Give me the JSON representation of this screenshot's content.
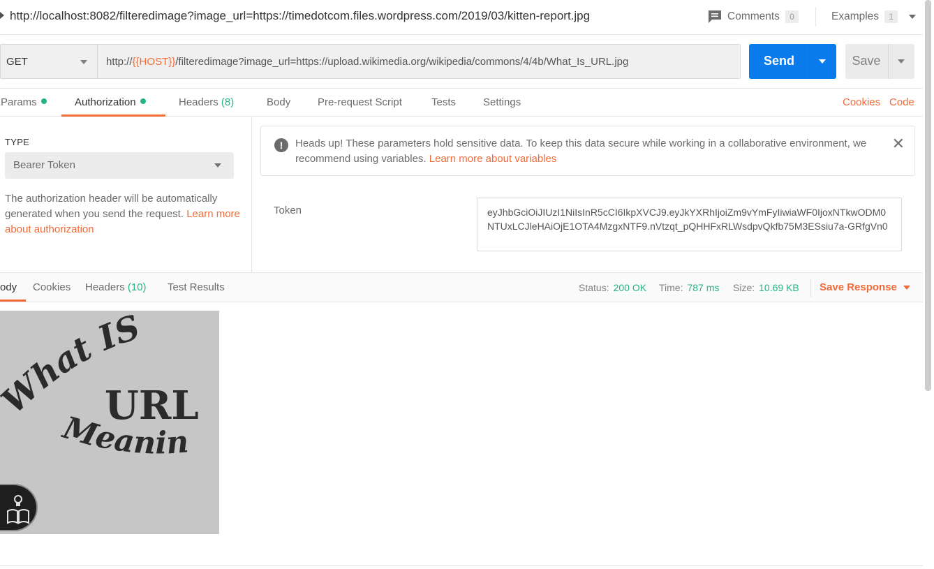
{
  "header": {
    "request_title": "http://localhost:8082/filteredimage?image_url=https://timedotcom.files.wordpress.com/2019/03/kitten-report.jpg",
    "comments_label": "Comments",
    "comments_count": "0",
    "examples_label": "Examples",
    "examples_count": "1"
  },
  "request": {
    "method": "GET",
    "url_prefix": "http://",
    "url_variable": "{{HOST}}",
    "url_suffix": "/filteredimage?image_url=https://upload.wikimedia.org/wikipedia/commons/4/4b/What_Is_URL.jpg",
    "send_label": "Send",
    "save_label": "Save"
  },
  "request_tabs": {
    "params": "Params",
    "authorization": "Authorization",
    "headers": "Headers",
    "headers_count": "(8)",
    "body": "Body",
    "prerequest": "Pre-request Script",
    "tests": "Tests",
    "settings": "Settings",
    "cookies": "Cookies",
    "code": "Code"
  },
  "auth": {
    "type_label": "TYPE",
    "type_value": "Bearer Token",
    "description": "The authorization header will be automatically generated when you send the request. ",
    "description_link": "Learn more about authorization",
    "notice_text": "Heads up! These parameters hold sensitive data. To keep this data secure while working in a collaborative environment, we recommend using variables. ",
    "notice_link": "Learn more about variables",
    "token_label": "Token",
    "token_value": "eyJhbGciOiJIUzI1NiIsInR5cCI6IkpXVCJ9.eyJkYXRhIjoiZm9vYmFyIiwiaWF0IjoxNTkwODM0NTUxLCJleHAiOjE1OTA4MzgxNTF9.nVtzqt_pQHHFxRLWsdpvQkfb75M3ESsiu7a-GRfgVn0"
  },
  "response": {
    "tabs": {
      "body": "ody",
      "cookies": "Cookies",
      "headers": "Headers",
      "headers_count": "(10)",
      "test_results": "Test Results"
    },
    "status_label": "Status:",
    "status_value": "200 OK",
    "time_label": "Time:",
    "time_value": "787 ms",
    "size_label": "Size:",
    "size_value": "10.69 KB",
    "save_response": "Save Response",
    "image_text": {
      "line1": "What IS",
      "line2": "URL",
      "line3": "Meaning"
    }
  },
  "colors": {
    "accent": "#f26b3a",
    "send_blue": "#097bed",
    "status_green": "#26b47f"
  }
}
